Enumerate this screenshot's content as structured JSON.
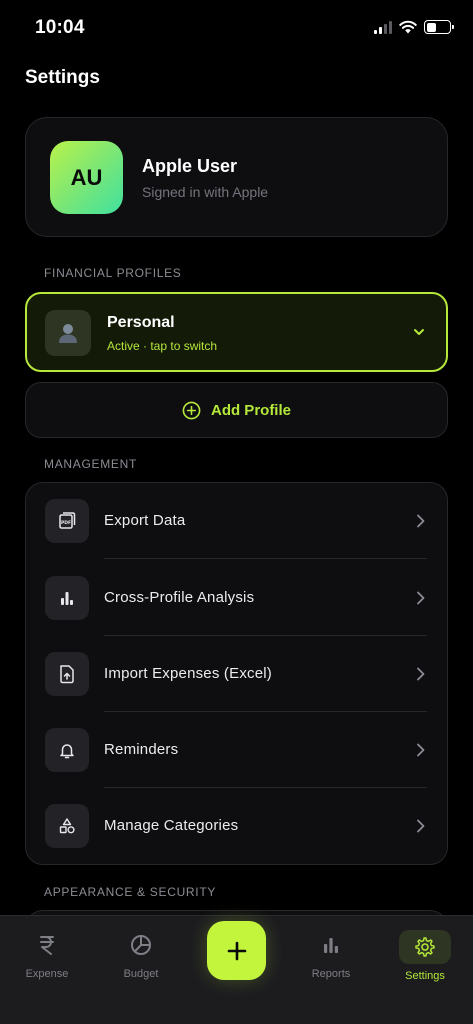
{
  "status_bar": {
    "time": "10:04"
  },
  "header": {
    "title": "Settings"
  },
  "account": {
    "initials": "AU",
    "name": "Apple User",
    "subtitle": "Signed in with Apple"
  },
  "financial_profiles": {
    "section_label": "FINANCIAL PROFILES",
    "active_profile": {
      "name": "Personal",
      "status": "Active · tap to switch"
    },
    "add_profile_label": "Add Profile"
  },
  "management": {
    "section_label": "MANAGEMENT",
    "items": [
      {
        "label": "Export Data",
        "icon": "pdf-file-icon"
      },
      {
        "label": "Cross-Profile Analysis",
        "icon": "bar-chart-icon"
      },
      {
        "label": "Import Expenses (Excel)",
        "icon": "file-upload-icon"
      },
      {
        "label": "Reminders",
        "icon": "bell-icon"
      },
      {
        "label": "Manage Categories",
        "icon": "shapes-icon"
      }
    ]
  },
  "appearance": {
    "section_label": "APPEARANCE & SECURITY"
  },
  "tab_bar": {
    "tabs": [
      {
        "label": "Expense",
        "icon": "rupee-icon",
        "active": false
      },
      {
        "label": "Budget",
        "icon": "pie-chart-icon",
        "active": false
      },
      {
        "label": "Reports",
        "icon": "bar-chart-icon",
        "active": false
      },
      {
        "label": "Settings",
        "icon": "gear-icon",
        "active": true
      }
    ],
    "add_button_icon": "plus-icon"
  },
  "colors": {
    "accent": "#b5e83a",
    "fab": "#c2f53c",
    "background": "#000000",
    "card": "#0e0e11",
    "muted_text": "#74747c"
  }
}
